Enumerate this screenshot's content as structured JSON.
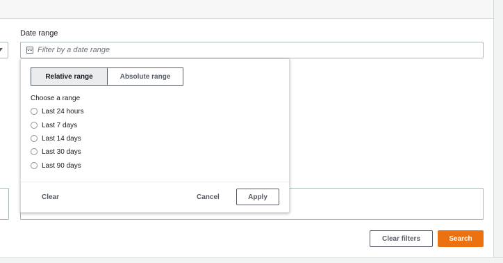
{
  "date_range": {
    "label": "Date range",
    "placeholder": "Filter by a date range"
  },
  "popover": {
    "tabs": [
      "Relative range",
      "Absolute range"
    ],
    "active_tab": "Relative range",
    "choose_label": "Choose a range",
    "options": [
      "Last 24 hours",
      "Last 7 days",
      "Last 14 days",
      "Last 30 days",
      "Last 90 days"
    ],
    "clear_label": "Clear",
    "cancel_label": "Cancel",
    "apply_label": "Apply"
  },
  "actions": {
    "clear_filters_label": "Clear filters",
    "search_label": "Search"
  },
  "colors": {
    "primary": "#ec7211",
    "border": "#aab7b8",
    "text": "#16191f"
  }
}
